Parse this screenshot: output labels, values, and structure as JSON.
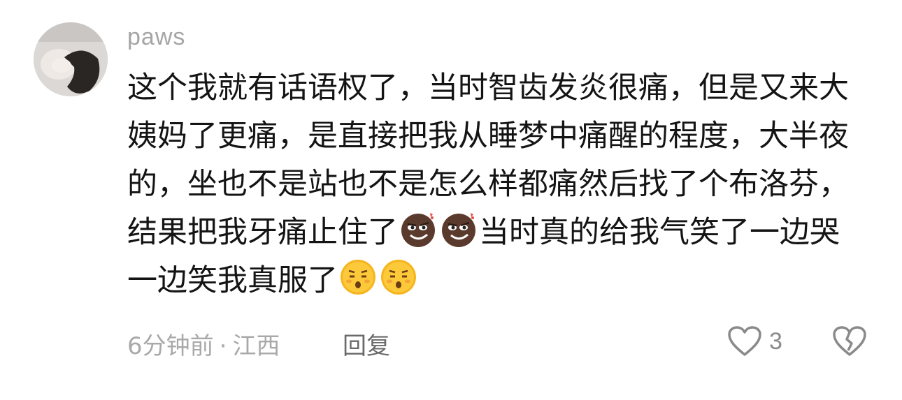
{
  "comment": {
    "username": "paws",
    "segments": [
      {
        "type": "text",
        "value": "这个我就有话语权了，当时智齿发炎很痛，但是又来大姨妈了更痛，是直接把我从睡梦中痛醒的程度，大半夜的，坐也不是站也不是怎么样都痛然后找了个布洛芬，结果把我牙痛止住了"
      },
      {
        "type": "emoji",
        "name": "smirk-brown-emoji"
      },
      {
        "type": "emoji",
        "name": "smirk-brown-emoji"
      },
      {
        "type": "text",
        "value": "当时真的给我气笑了一边哭一边笑我真服了"
      },
      {
        "type": "emoji",
        "name": "speechless-yellow-emoji"
      },
      {
        "type": "emoji",
        "name": "speechless-yellow-emoji"
      }
    ],
    "time": "6分钟前",
    "separator": "·",
    "location": "江西",
    "reply_label": "回复",
    "like_count": "3"
  },
  "colors": {
    "username": "#a5a5a5",
    "text": "#141414",
    "meta": "#a9a9a9",
    "icon": "#8a8a8a"
  }
}
